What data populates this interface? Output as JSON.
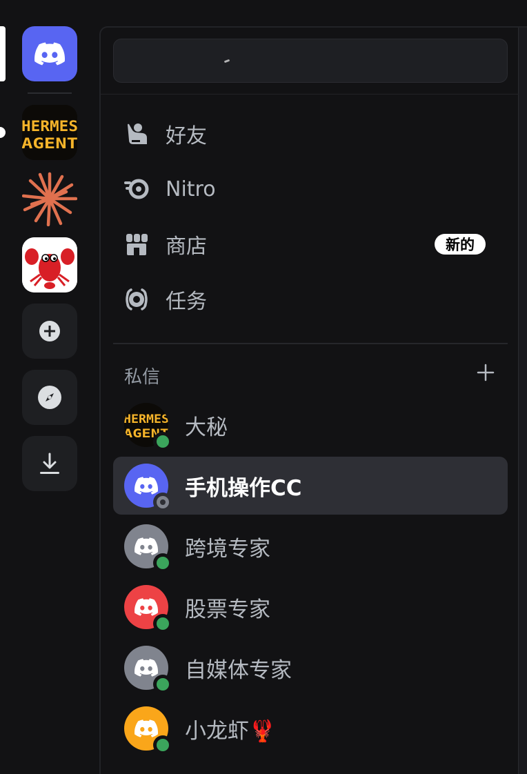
{
  "nav": [
    {
      "label": "好友",
      "icon": "friends-icon"
    },
    {
      "label": "Nitro",
      "icon": "nitro-icon"
    },
    {
      "label": "商店",
      "icon": "shop-icon",
      "badge": "新的"
    },
    {
      "label": "任务",
      "icon": "quests-icon"
    }
  ],
  "dm_section": {
    "title": "私信"
  },
  "dms": [
    {
      "name": "大秘",
      "status": "online",
      "avatar": "hermes-agent"
    },
    {
      "name": "手机操作CC",
      "status": "offline",
      "avatar": "discord-blurple",
      "selected": true
    },
    {
      "name": "跨境专家",
      "status": "online",
      "avatar": "discord-gray"
    },
    {
      "name": "股票专家",
      "status": "online",
      "avatar": "discord-red"
    },
    {
      "name": "自媒体专家",
      "status": "online",
      "avatar": "discord-gray"
    },
    {
      "name": "小龙虾🦞",
      "status": "online",
      "avatar": "discord-orange"
    }
  ],
  "servers": {
    "home": "discord-home-icon",
    "items": [
      "hermes-agent",
      "claude-burst",
      "red-lobster"
    ],
    "hermes_logo_text": [
      "HERMES",
      "AGENT"
    ],
    "actions": [
      "add-server-icon",
      "discover-icon",
      "download-icon"
    ]
  },
  "colors": {
    "blurple": "#5865f2",
    "gray_avatar": "#80848e",
    "red_avatar": "#ed4245",
    "orange_avatar": "#faa61a",
    "online": "#3ba55c",
    "burst": "#e0714f"
  }
}
